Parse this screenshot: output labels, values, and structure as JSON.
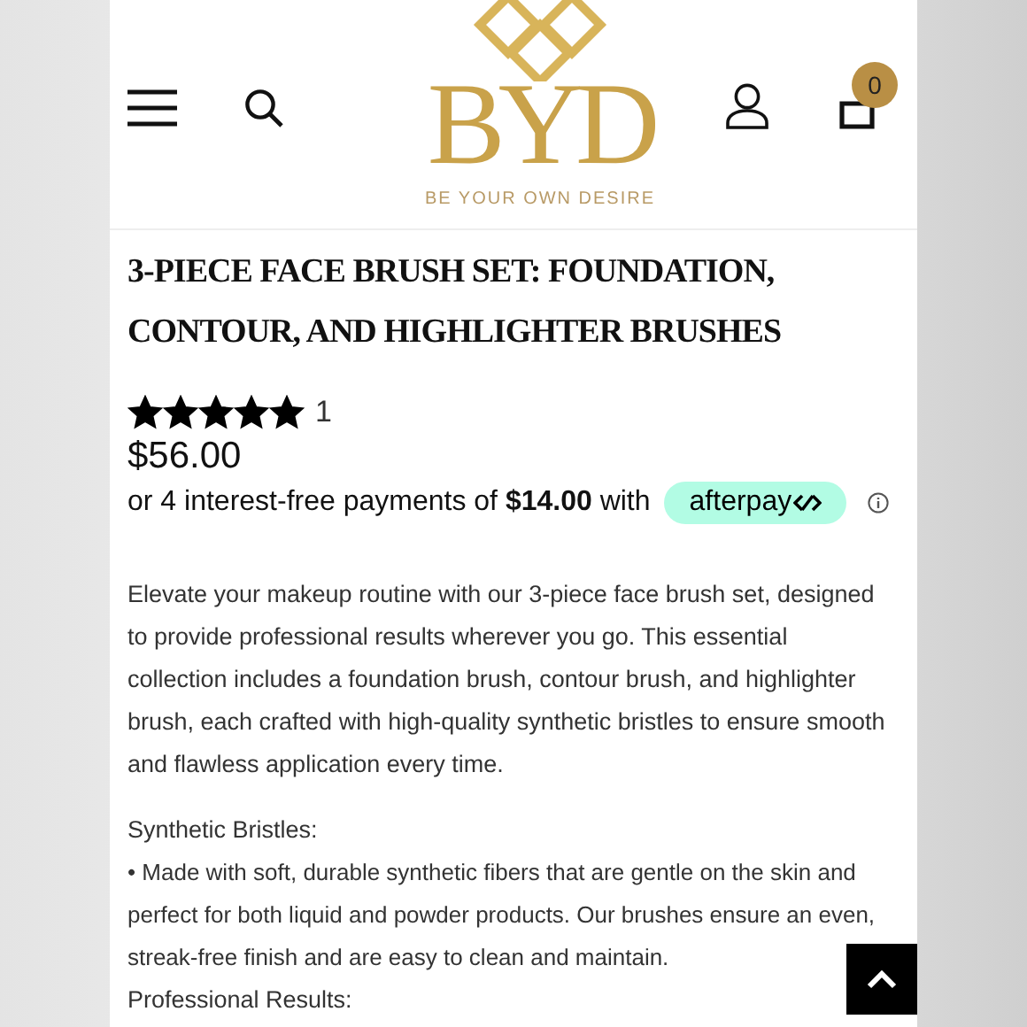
{
  "header": {
    "logo_text": "BYD",
    "tagline": "BE YOUR OWN DESIRE",
    "cart_count": "0"
  },
  "product": {
    "title": "3-PIECE FACE BRUSH SET: FOUNDATION, CONTOUR, AND HIGHLIGHTER BRUSHES",
    "stars": 5,
    "review_count": "1",
    "price": "$56.00",
    "installments": "or 4 interest-free payments of **$14.00** with",
    "afterpay_label": "afterpay"
  },
  "description": [
    {
      "kind": "paragraph",
      "text": "Elevate your makeup routine with our 3-piece face brush set, designed to provide professional results wherever you go. This essential collection includes a foundation brush, contour brush, and highlighter brush, each crafted with high-quality synthetic bristles to ensure smooth and flawless application every time."
    },
    {
      "kind": "heading",
      "text": "Synthetic Bristles:"
    },
    {
      "kind": "bullet",
      "text": "• Made with soft, durable synthetic fibers that are gentle on the skin and perfect for both liquid and powder products. Our brushes ensure an even, streak-free finish and are easy to clean and maintain."
    },
    {
      "kind": "heading",
      "text": "Professional Results:"
    }
  ]
}
